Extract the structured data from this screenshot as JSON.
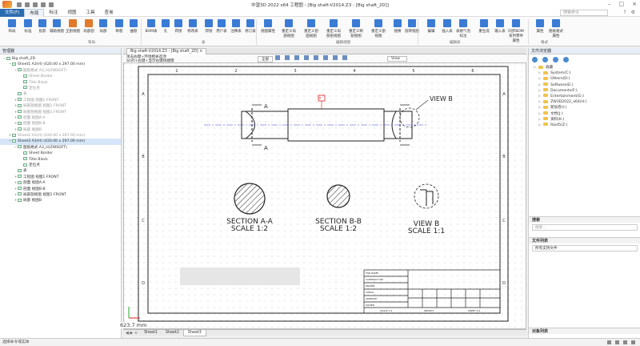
{
  "titlebar": {
    "title": "中望3D 2022 x64   工程图 - [Big shaft-V2014.Z3 - [Big shaft_2D]]"
  },
  "menu": {
    "items": [
      "文件(F)",
      "布局",
      "标注",
      "视图",
      "工具",
      "查询"
    ],
    "search_placeholder": "搜索命令"
  },
  "ribbon": {
    "buttons": [
      {
        "label": "布局",
        "color": "#3a7bd5"
      },
      {
        "label": "标准",
        "color": "#3a7bd5"
      },
      {
        "label": "投影",
        "color": "#3a7bd5"
      },
      {
        "label": "辅助视图",
        "color": "#3a7bd5"
      },
      {
        "label": "全剖视图",
        "color": "#e07a2a"
      },
      {
        "label": "局部剖",
        "color": "#e07a2a"
      },
      {
        "label": "局部",
        "color": "#3a7bd5"
      },
      {
        "label": "断裂",
        "color": "#3a7bd5"
      },
      {
        "label": "曲裂",
        "color": "#3a7bd5"
      },
      {
        "label": "BOM表",
        "color": "#3a7bd5"
      },
      {
        "label": "孔",
        "color": "#3a7bd5"
      },
      {
        "label": "焊接",
        "color": "#3a7bd5"
      },
      {
        "label": "修改表",
        "color": "#3a7bd5"
      },
      {
        "label": "焊接",
        "color": "#3a7bd5"
      },
      {
        "label": "用户表",
        "color": "#3a7bd5"
      },
      {
        "label": "注释表",
        "color": "#3a7bd5"
      },
      {
        "label": "修订表",
        "color": "#3a7bd5"
      },
      {
        "label": "视图属性",
        "color": "#3a7bd5"
      },
      {
        "label": "重定义局部视图",
        "color": "#3a7bd5"
      },
      {
        "label": "重定义剖面视图",
        "color": "#3a7bd5"
      },
      {
        "label": "重定义局部剖视图",
        "color": "#3a7bd5"
      },
      {
        "label": "重定义断裂视图",
        "color": "#3a7bd5"
      },
      {
        "label": "重定义剖视图",
        "color": "#3a7bd5"
      },
      {
        "label": "替换",
        "color": "#3a7bd5"
      },
      {
        "label": "旋转视图",
        "color": "#3a7bd5"
      },
      {
        "label": "编辑",
        "color": "#3a7bd5"
      },
      {
        "label": "插入表",
        "color": "#3a7bd5"
      },
      {
        "label": "表格气泡标注",
        "color": "#3a7bd5"
      },
      {
        "label": "重生成",
        "color": "#3a7bd5"
      },
      {
        "label": "输入表",
        "color": "#3a7bd5"
      },
      {
        "label": "同步BOM系列零件属性",
        "color": "#3a7bd5"
      },
      {
        "label": "属性",
        "color": "#3a7bd5"
      },
      {
        "label": "图纸格式属性",
        "color": "#3a7bd5"
      }
    ],
    "groups": [
      "布局",
      "表",
      "编辑视图",
      "编辑表",
      "格式"
    ]
  },
  "left": {
    "title": "管理器",
    "tree": [
      {
        "t": "Big shaft_2D",
        "lv": 0,
        "tw": "−"
      },
      {
        "t": "Sheet1 A3(H) (420.00 x 297.00 mm)",
        "lv": 1,
        "tw": "−"
      },
      {
        "t": "图纸格式 A3_H(ZWSOFT)",
        "lv": 2,
        "tw": "−",
        "dim": true
      },
      {
        "t": "Sheet Border",
        "lv": 3,
        "dim": true
      },
      {
        "t": "Title Block",
        "lv": 3,
        "dim": true
      },
      {
        "t": "定位点",
        "lv": 3,
        "dim": true
      },
      {
        "t": "表",
        "lv": 2,
        "dim": true
      },
      {
        "t": "工程图 视图1 FRONT",
        "lv": 2,
        "tw": "+",
        "dim": true
      },
      {
        "t": "局部剖视图 视图1 FRONT",
        "lv": 2,
        "tw": "+",
        "dim": true
      },
      {
        "t": "局部剖视图 视图1 FRONT",
        "lv": 2,
        "tw": "+",
        "dim": true
      },
      {
        "t": "剖面 视图A-A",
        "lv": 2,
        "tw": "+",
        "dim": true
      },
      {
        "t": "剖面 视图B-B",
        "lv": 2,
        "tw": "+",
        "dim": true
      },
      {
        "t": "局部 视图B",
        "lv": 2,
        "tw": "+",
        "dim": true
      },
      {
        "t": "Sheet2 A3(H) (420.00 x 297.00 mm)",
        "lv": 1,
        "tw": "+",
        "dim": true
      },
      {
        "t": "Sheet3 A3(H) (420.00 x 297.00 mm)",
        "lv": 1,
        "tw": "−",
        "sel": true
      },
      {
        "t": "图纸格式 A3_H(ZWSOFT)",
        "lv": 2,
        "tw": "−"
      },
      {
        "t": "Sheet Border",
        "lv": 3
      },
      {
        "t": "Title Block",
        "lv": 3
      },
      {
        "t": "定位点",
        "lv": 3
      },
      {
        "t": "表",
        "lv": 2
      },
      {
        "t": "工程图 视图1 FRONT",
        "lv": 2,
        "tw": "+"
      },
      {
        "t": "剖面 视图A-A",
        "lv": 2,
        "tw": "+"
      },
      {
        "t": "剖面 视图B-B",
        "lv": 2,
        "tw": "+"
      },
      {
        "t": "局部剖视图 视图1 FRONT",
        "lv": 2,
        "tw": "+"
      },
      {
        "t": "局部 视图B",
        "lv": 2,
        "tw": "+"
      }
    ]
  },
  "drawing": {
    "tabs": [
      "Big shaft-V2014.Z3 - [Big shaft_2D]"
    ],
    "hint1": "单击右键+环境相关选项",
    "hint2": "Shift+右键+显示右键快捷键",
    "toolbar_all": "全部",
    "toolbar_view": "View",
    "coordinate": "623.7 mm",
    "sheets": [
      "Sheet1",
      "Sheet2",
      "Sheet3"
    ],
    "active_sheet": "Sheet3",
    "section_aa": [
      "SECTION A-A",
      "SCALE 1:2"
    ],
    "section_bb": [
      "SECTION B-B",
      "SCALE 1:2"
    ],
    "view_b": [
      "VIEW B",
      "SCALE 1:1"
    ],
    "view_b_label": "VIEW B",
    "label_a": "A",
    "row_labels": [
      "A",
      "B",
      "C",
      "D"
    ],
    "col_labels": [
      "1",
      "2",
      "3",
      "4",
      "5",
      "6"
    ],
    "tb_rows": [
      "FILE NAME",
      "CONTRACT NO",
      "DRAWN",
      "CHECK",
      "APPROVE",
      "ISSUED"
    ],
    "tb_bottom": [
      "SCALE 1:2",
      "WEIGHT",
      "SHEET 1/1"
    ]
  },
  "right": {
    "title": "文件浏览器",
    "folders": [
      "收藏",
      "System(C:)",
      "Others(D:)",
      "Software(E:)",
      "Documents(F:)",
      "Entertainment(G:)",
      "ZW3D2022_x64(H:)",
      "新加卷(I:)",
      "文档(J:)",
      "资料(K:)",
      "Raid5(Z:)"
    ],
    "search_label": "搜索",
    "search_placeholder": "搜索...",
    "filelist_label": "文件列表",
    "filter": "所有支持文件",
    "objlist_label": "对象列表"
  },
  "status": {
    "text": "选择命令或实体"
  }
}
